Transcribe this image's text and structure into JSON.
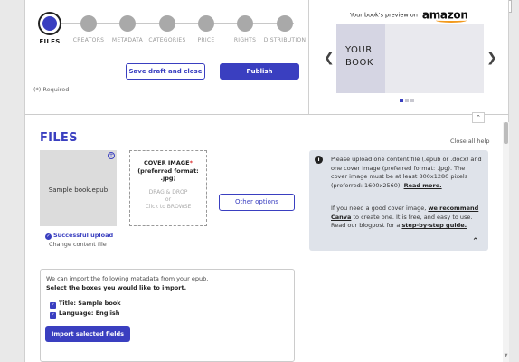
{
  "stepper": {
    "steps": [
      {
        "label": "FILES",
        "active": true
      },
      {
        "label": "CREATORS",
        "active": false
      },
      {
        "label": "METADATA",
        "active": false
      },
      {
        "label": "CATEGORIES",
        "active": false
      },
      {
        "label": "PRICE",
        "active": false
      },
      {
        "label": "RIGHTS",
        "active": false
      },
      {
        "label": "DISTRIBUTION",
        "active": false
      }
    ]
  },
  "actions": {
    "draft_label": "Save draft and close",
    "publish_label": "Publish",
    "required_note": "(*) Required"
  },
  "preview": {
    "heading": "Your book's preview on",
    "brand": "amazon",
    "book_title_line1": "YOUR",
    "book_title_line2": "BOOK",
    "prev_icon": "chevron-left-icon",
    "next_icon": "chevron-right-icon"
  },
  "files": {
    "title": "FILES",
    "close_help": "Close all help",
    "uploaded_file": "Sample book.epub",
    "upload_status": "Successful upload",
    "change_label": "Change content file",
    "cover_title": "COVER IMAGE",
    "cover_required_mark": "*",
    "cover_format": "(preferred format: .jpg)",
    "drag_line1": "DRAG & DROP",
    "drag_line2": "or",
    "drag_line3": "Click to BROWSE",
    "other_options": "Other options"
  },
  "info": {
    "p1_text": "Please upload one content file (.epub or .docx) and one cover image (preferred format: .jpg). The cover image must be at least 800x1280 pixels (preferred: 1600x2560).",
    "p1_link": "Read more.",
    "p2_text_a": "If you need a good cover image,",
    "p2_link_a": "we recommend Canva",
    "p2_text_b": "to create one. It is free, and easy to use. Read our blogpost for a",
    "p2_link_b": "step-by-step guide."
  },
  "metadata_import": {
    "line1": "We can import the following metadata from your epub.",
    "line2": "Select the boxes you would like to import.",
    "options": [
      {
        "label": "Title: Sample book",
        "checked": true
      },
      {
        "label": "Language: English",
        "checked": true
      }
    ],
    "import_button": "Import selected fields"
  },
  "colors": {
    "accent": "#3a3fc0",
    "amazon_orange": "#f29a1e"
  }
}
